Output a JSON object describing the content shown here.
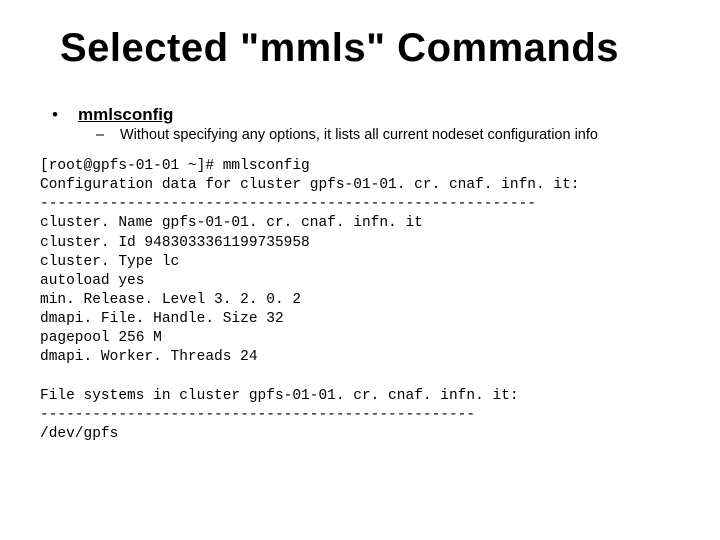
{
  "title": "Selected \"mmls\" Commands",
  "bullet": {
    "command": "mmlsconfig",
    "description": "Without specifying any options, it lists all current nodeset configuration info"
  },
  "terminal": {
    "lines": [
      "[root@gpfs-01-01 ~]# mmlsconfig",
      "Configuration data for cluster gpfs-01-01. cr. cnaf. infn. it:",
      "---------------------------------------------------------",
      "cluster. Name gpfs-01-01. cr. cnaf. infn. it",
      "cluster. Id 9483033361199735958",
      "cluster. Type lc",
      "autoload yes",
      "min. Release. Level 3. 2. 0. 2",
      "dmapi. File. Handle. Size 32",
      "pagepool 256 M",
      "dmapi. Worker. Threads 24",
      "",
      "File systems in cluster gpfs-01-01. cr. cnaf. infn. it:",
      "--------------------------------------------------",
      "/dev/gpfs"
    ]
  }
}
